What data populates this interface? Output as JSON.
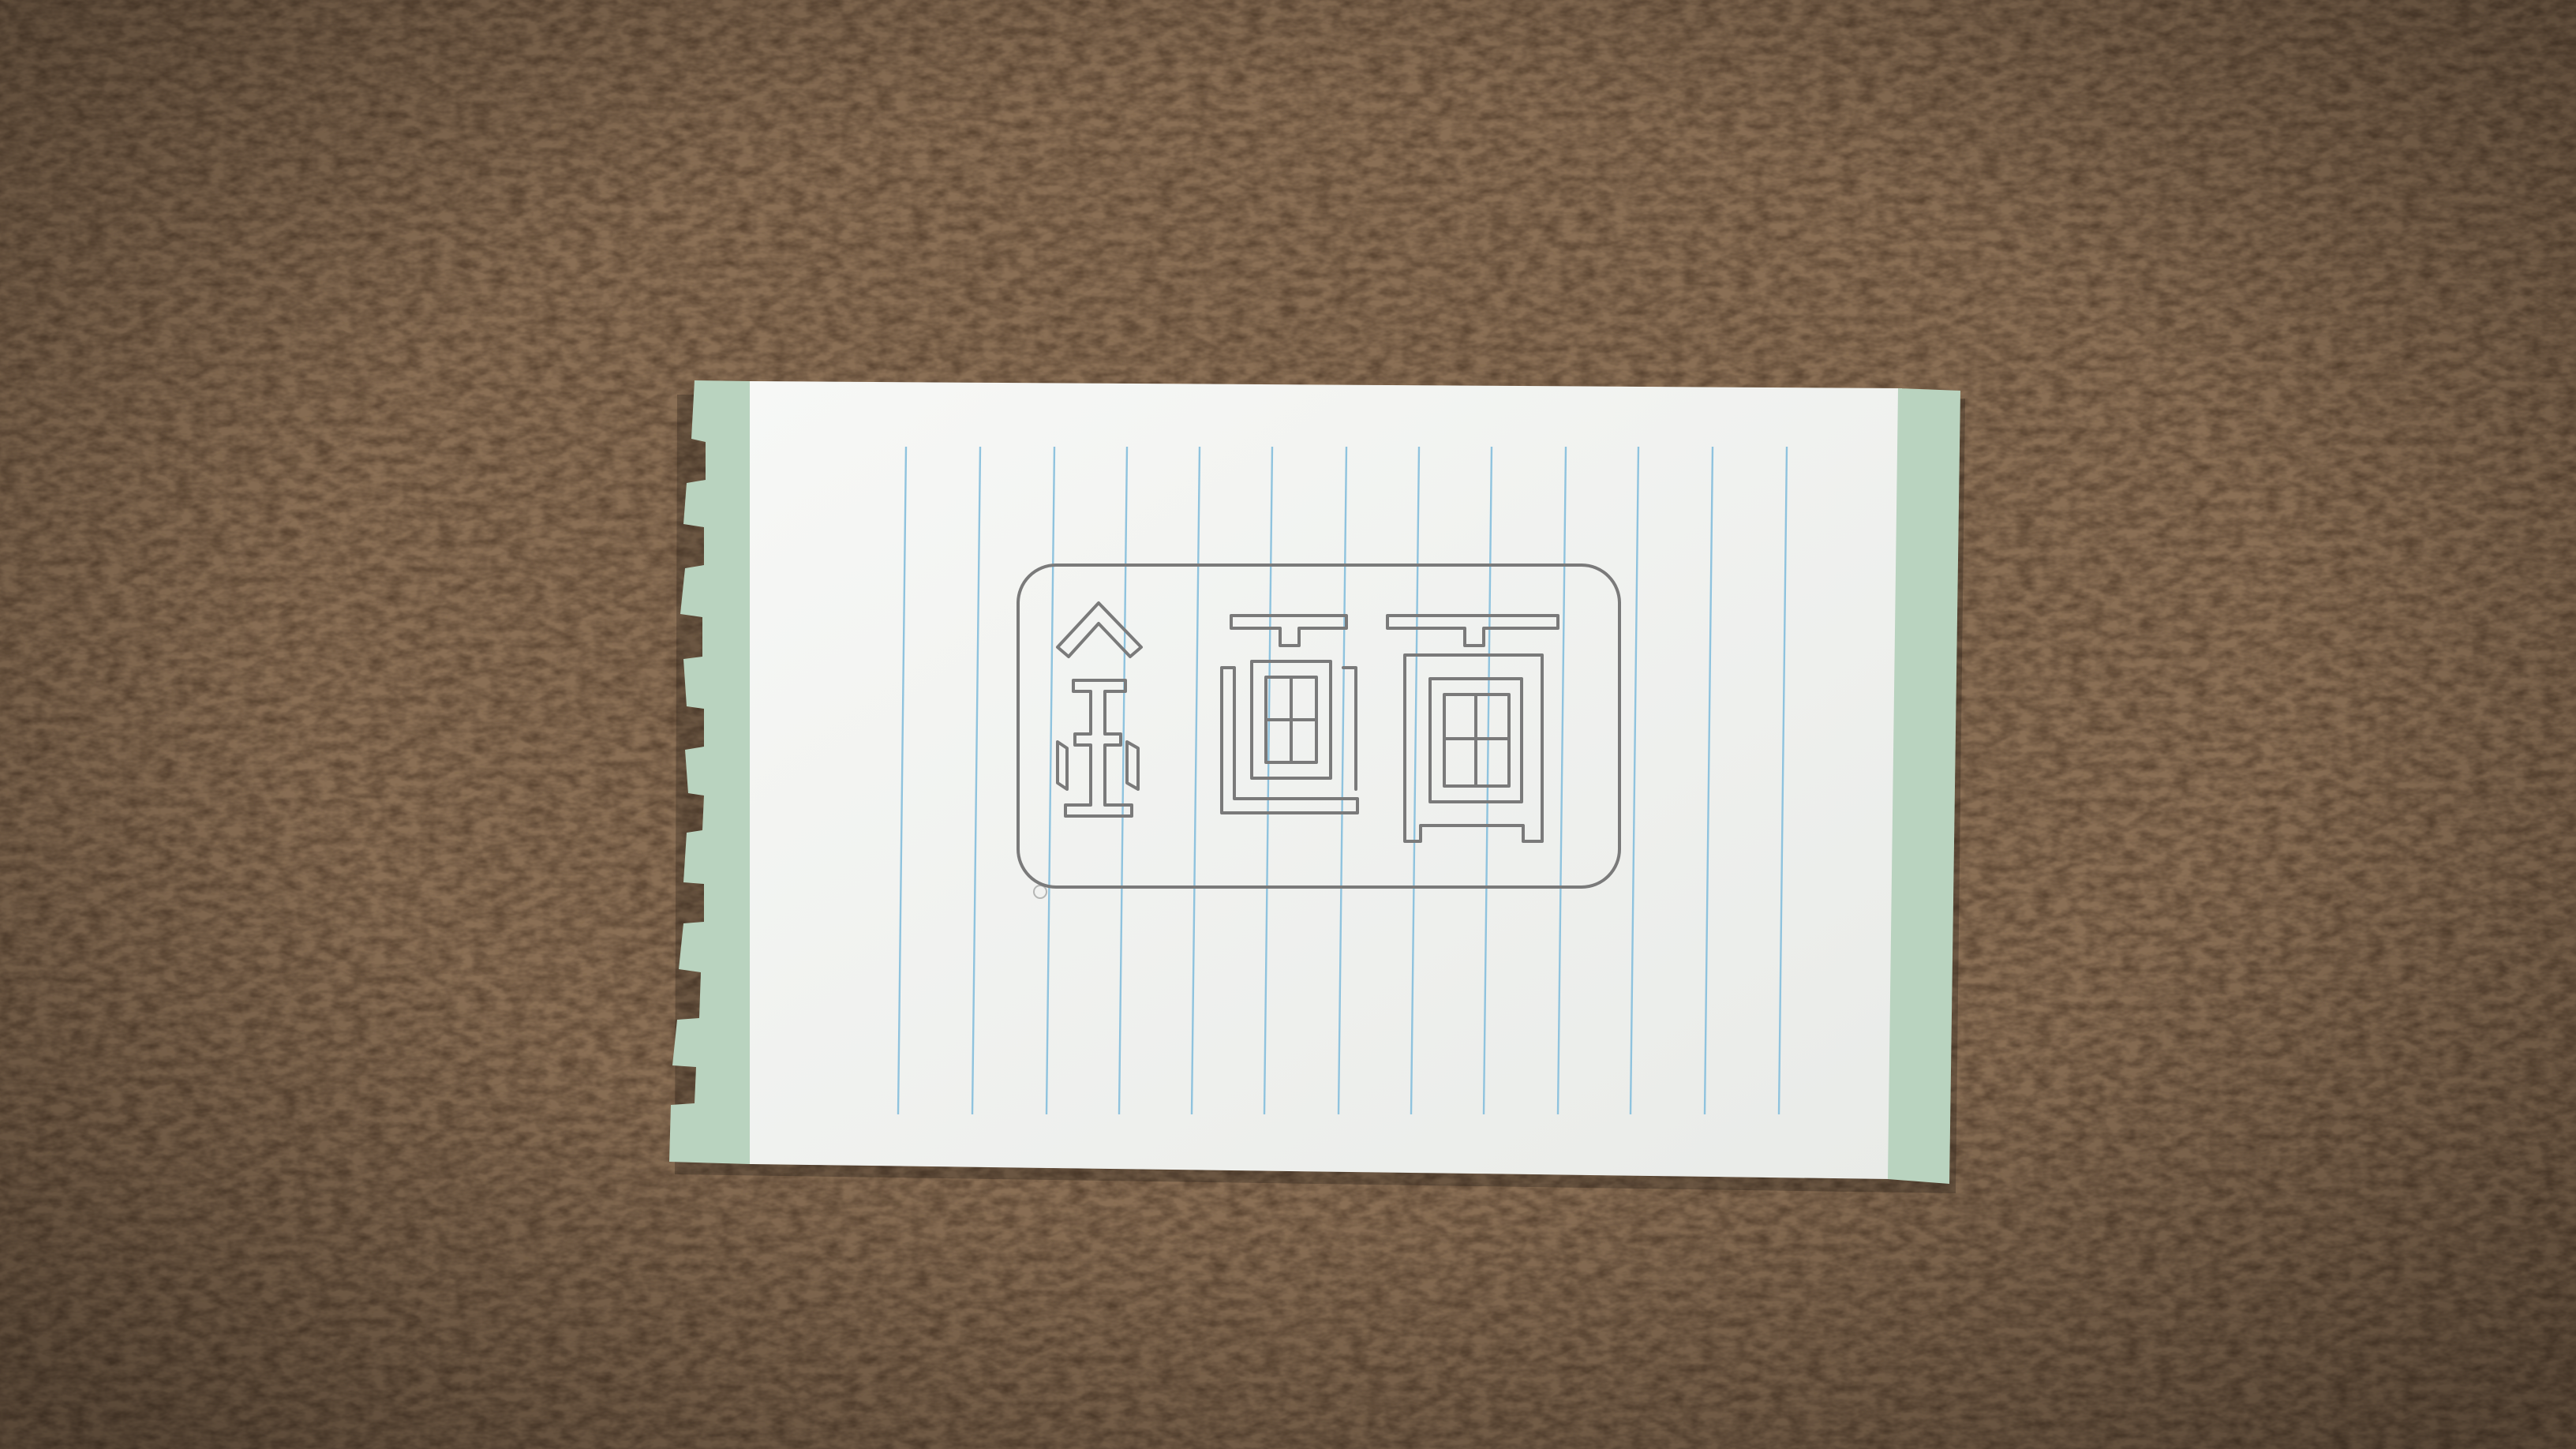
{
  "scene": {
    "description_label": "",
    "drawing": {
      "characters": [
        "金",
        "画",
        "画"
      ]
    }
  },
  "colors": {
    "carpet_base": "#8a6f55",
    "carpet_dark": "#5c4633",
    "carpet_light": "#b39a7d",
    "paper": "#f3f4f2",
    "paper_shadow": "#d9dbd7",
    "margin_green": "#b9d3bf",
    "rule_blue": "#8fc3de",
    "pencil": "#7a7a7a"
  }
}
